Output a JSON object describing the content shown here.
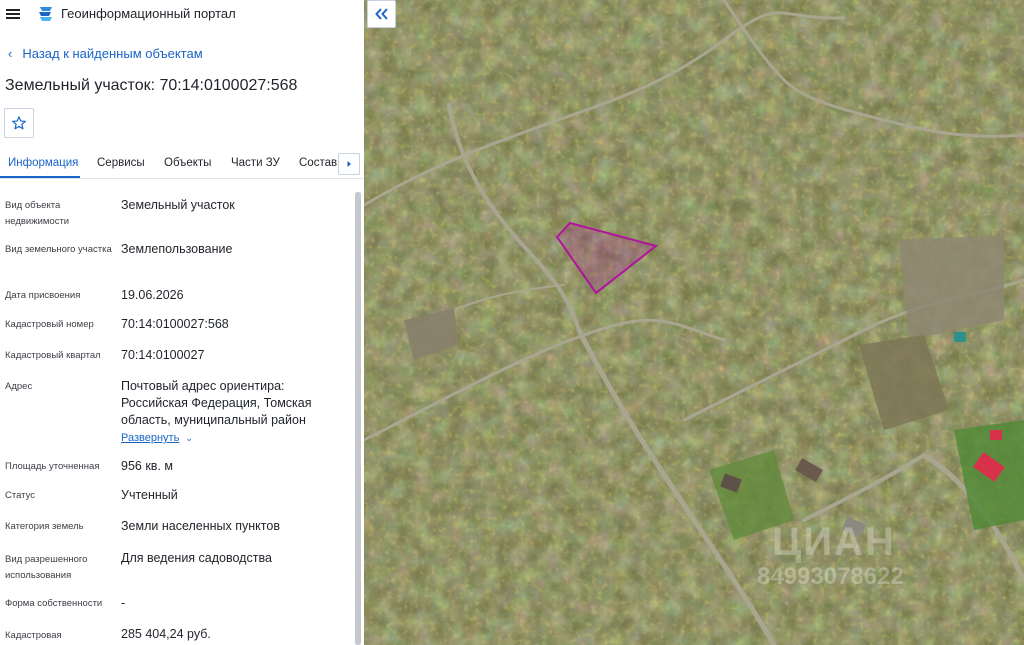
{
  "header": {
    "title": "Геоинформационный портал"
  },
  "nav": {
    "back_label": "Назад к найденным объектам"
  },
  "object": {
    "title": "Земельный участок: 70:14:0100027:568"
  },
  "tabs": [
    {
      "label": "Информация"
    },
    {
      "label": "Сервисы"
    },
    {
      "label": "Объекты"
    },
    {
      "label": "Части ЗУ"
    },
    {
      "label": "Состав"
    }
  ],
  "rows": [
    {
      "label": "Вид объекта недвижимости",
      "value": "Земельный участок"
    },
    {
      "label": "Вид земельного участка",
      "value": "Землепользование"
    },
    {
      "label": "Дата присвоения",
      "value": "19.06.2026"
    },
    {
      "label": "Кадастровый номер",
      "value": "70:14:0100027:568"
    },
    {
      "label": "Кадастровый квартал",
      "value": "70:14:0100027"
    },
    {
      "label": "Адрес",
      "value": "Почтовый адрес ориентира: Российская Федерация, Томская область, муниципальный район",
      "link": "Развернуть"
    },
    {
      "label": "Площадь уточненная",
      "value": "956 кв. м"
    },
    {
      "label": "Статус",
      "value": "Учтенный"
    },
    {
      "label": "Категория земель",
      "value": "Земли населенных пунктов"
    },
    {
      "label": "Вид разрешенного использования",
      "value": "Для ведения садоводства"
    },
    {
      "label": "Форма собственности",
      "value": "-"
    },
    {
      "label": "Кадастровая",
      "value": "285 404,24 руб."
    }
  ],
  "map": {
    "parcel_color": "#b0149e",
    "watermark": "ЦИАН",
    "watermark_sub": "84993078622"
  },
  "icons": {
    "menu": "hamburger-icon",
    "logo": "portal-logo-icon",
    "back": "chevron-left-icon",
    "favorite": "star-icon",
    "tabs_next": "chevron-right-icon",
    "expand": "chevron-down-icon",
    "collapse": "double-chevron-left-icon"
  },
  "colors": {
    "accent": "#1a64c8",
    "map_base": "#6f7244"
  }
}
